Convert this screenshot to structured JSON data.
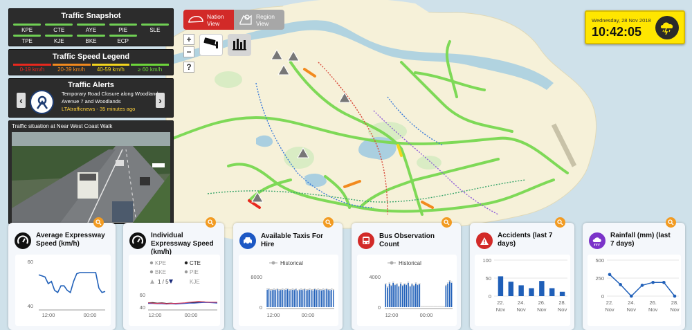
{
  "snapshot": {
    "title": "Traffic Snapshot",
    "expressways": [
      "KPE",
      "CTE",
      "AYE",
      "PIE",
      "SLE",
      "TPE",
      "KJE",
      "BKE",
      "ECP"
    ]
  },
  "speed_legend": {
    "title": "Traffic Speed Legend",
    "items": [
      {
        "label": "0-19 km/h",
        "color": "#e8281e"
      },
      {
        "label": "20-39 km/h",
        "color": "#f28a1e"
      },
      {
        "label": "40-59 km/h",
        "color": "#f2d51e"
      },
      {
        "label": "≥ 60 km/h",
        "color": "#6dd63a"
      }
    ]
  },
  "alerts": {
    "title": "Traffic Alerts",
    "message": "Temporary Road Closure along Woodlands Avenue 7 and Woodlands",
    "source": "LTAtrafficnews - 35 minutes ago"
  },
  "camera": {
    "title": "Traffic situation at Near West Coast Walk"
  },
  "view_toggle": {
    "nation": "Nation View",
    "region": "Region View"
  },
  "zoom": {
    "plus": "+",
    "minus": "−",
    "help": "?"
  },
  "clock": {
    "date": "Wednesday, 28 Nov 2018",
    "time": "10:42:05",
    "weather_icon": "thunderstorm-icon"
  },
  "cards": {
    "avg_speed": {
      "title": "Average Expressway Speed (km/h)",
      "icon": "speedometer-icon",
      "chart_data": {
        "type": "line",
        "ylim": [
          40,
          60
        ],
        "yticks": [
          "60",
          "40"
        ],
        "xticks": [
          "12:00",
          "00:00"
        ],
        "values": [
          54,
          53.5,
          53,
          50,
          51,
          47,
          46,
          49,
          49,
          47,
          46,
          51,
          54.5,
          55,
          55,
          55,
          55,
          55,
          55,
          48,
          46,
          46.5
        ]
      }
    },
    "ind_speed": {
      "title": "Individual Expressway Speed (km/h)",
      "icon": "speedometer-icon",
      "legend": [
        "KPE",
        "CTE",
        "BKE",
        "PIE",
        "KJE"
      ],
      "page": "1 / 5",
      "chart_data": {
        "type": "line",
        "ylim": [
          40,
          60
        ],
        "yticks": [
          "60",
          "40"
        ],
        "xticks": [
          "12:00",
          "00:00"
        ],
        "series": [
          {
            "name": "CTE",
            "color": "#222222",
            "values": [
              47,
              47.5,
              46.5,
              47,
              46,
              46.5,
              45.5,
              46,
              46.5,
              47,
              47.5,
              48,
              48.5,
              48,
              47.5,
              47
            ]
          },
          {
            "name": "PIE",
            "color": "#3355cc",
            "values": [
              46,
              46,
              45.5,
              45.5,
              45,
              45.5,
              45,
              45.5,
              46,
              46.5,
              46.5,
              47,
              47.5,
              47.5,
              47,
              46.5
            ]
          },
          {
            "name": "KJE",
            "color": "#d63a5a",
            "values": [
              47,
              46.5,
              46,
              46.5,
              45.5,
              46,
              46,
              46.5,
              47,
              48,
              48.5,
              49,
              48.5,
              48,
              48,
              48
            ]
          }
        ]
      }
    },
    "taxis": {
      "title": "Available Taxis For Hire",
      "icon": "taxi-icon",
      "legend": "Historical",
      "chart_data": {
        "type": "bar",
        "ylim": [
          0,
          8000
        ],
        "yticks": [
          "8000",
          "0"
        ],
        "xticks": [
          "12:00",
          "00:00"
        ],
        "values": [
          4600,
          4700,
          4400,
          4500,
          4600,
          4500,
          4700,
          4400,
          4500,
          4600,
          4500,
          4600,
          4700,
          4400,
          4500,
          4600,
          4500,
          4700,
          4300,
          4500,
          4600,
          4500,
          4700,
          4400,
          4500,
          4600,
          4500,
          4400,
          4700,
          4500,
          4600,
          4500,
          4400,
          4600,
          4500,
          4700,
          4500,
          4400,
          4600,
          4500
        ]
      }
    },
    "bus": {
      "title": "Bus Observation Count",
      "icon": "bus-icon",
      "legend": "Historical",
      "chart_data": {
        "type": "bar",
        "ylim": [
          0,
          4000
        ],
        "yticks": [
          "4000",
          "0"
        ],
        "xticks": [
          "12:00",
          "00:00"
        ],
        "values": [
          3000,
          2600,
          3100,
          2800,
          3200,
          2900,
          3000,
          2700,
          3100,
          2800,
          3000,
          2900,
          3200,
          2700,
          3000,
          2800,
          3100,
          2900,
          3000,
          0,
          0,
          0,
          0,
          0,
          0,
          0,
          0,
          0,
          0,
          0,
          0,
          0,
          2800,
          3100,
          3400,
          3200
        ]
      }
    },
    "accidents": {
      "title": "Accidents (last 7 days)",
      "icon": "warning-icon",
      "chart_data": {
        "type": "bar",
        "ylim": [
          0,
          100
        ],
        "yticks": [
          "100",
          "50",
          "0"
        ],
        "categories": [
          "22. Nov",
          "24. Nov",
          "26. Nov",
          "28. Nov"
        ],
        "values": [
          55,
          40,
          30,
          22,
          42,
          22,
          12
        ]
      }
    },
    "rainfall": {
      "title": "Rainfall (mm) (last 7 days)",
      "icon": "rain-cloud-icon",
      "chart_data": {
        "type": "line",
        "ylim": [
          0,
          500
        ],
        "yticks": [
          "500",
          "250",
          "0"
        ],
        "categories": [
          "22. Nov",
          "24. Nov",
          "26. Nov",
          "28. Nov"
        ],
        "values": [
          300,
          160,
          0,
          150,
          190,
          190,
          0
        ]
      }
    }
  },
  "colors": {
    "accent": "#f29b22",
    "brand_red": "#d22a28",
    "road_green": "#7ed957"
  }
}
